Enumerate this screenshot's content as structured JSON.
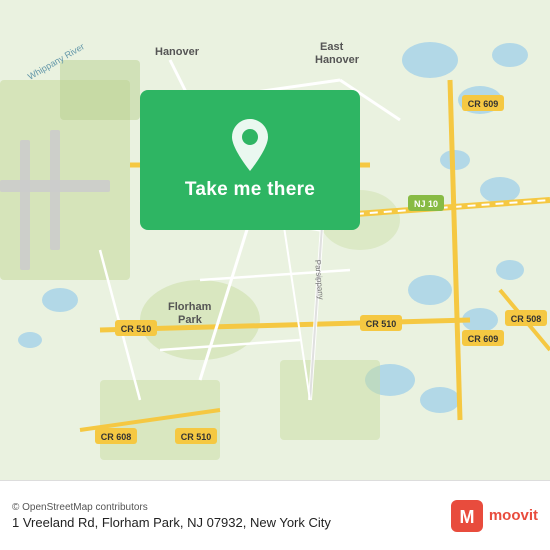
{
  "map": {
    "alt": "Map of Florham Park, NJ area",
    "center_lat": 40.7862,
    "center_lng": -74.4002
  },
  "button": {
    "label": "Take me there"
  },
  "footer": {
    "osm_credit": "© OpenStreetMap contributors",
    "address": "1 Vreeland Rd, Florham Park, NJ 07932, New York City",
    "moovit_label": "moovit"
  }
}
